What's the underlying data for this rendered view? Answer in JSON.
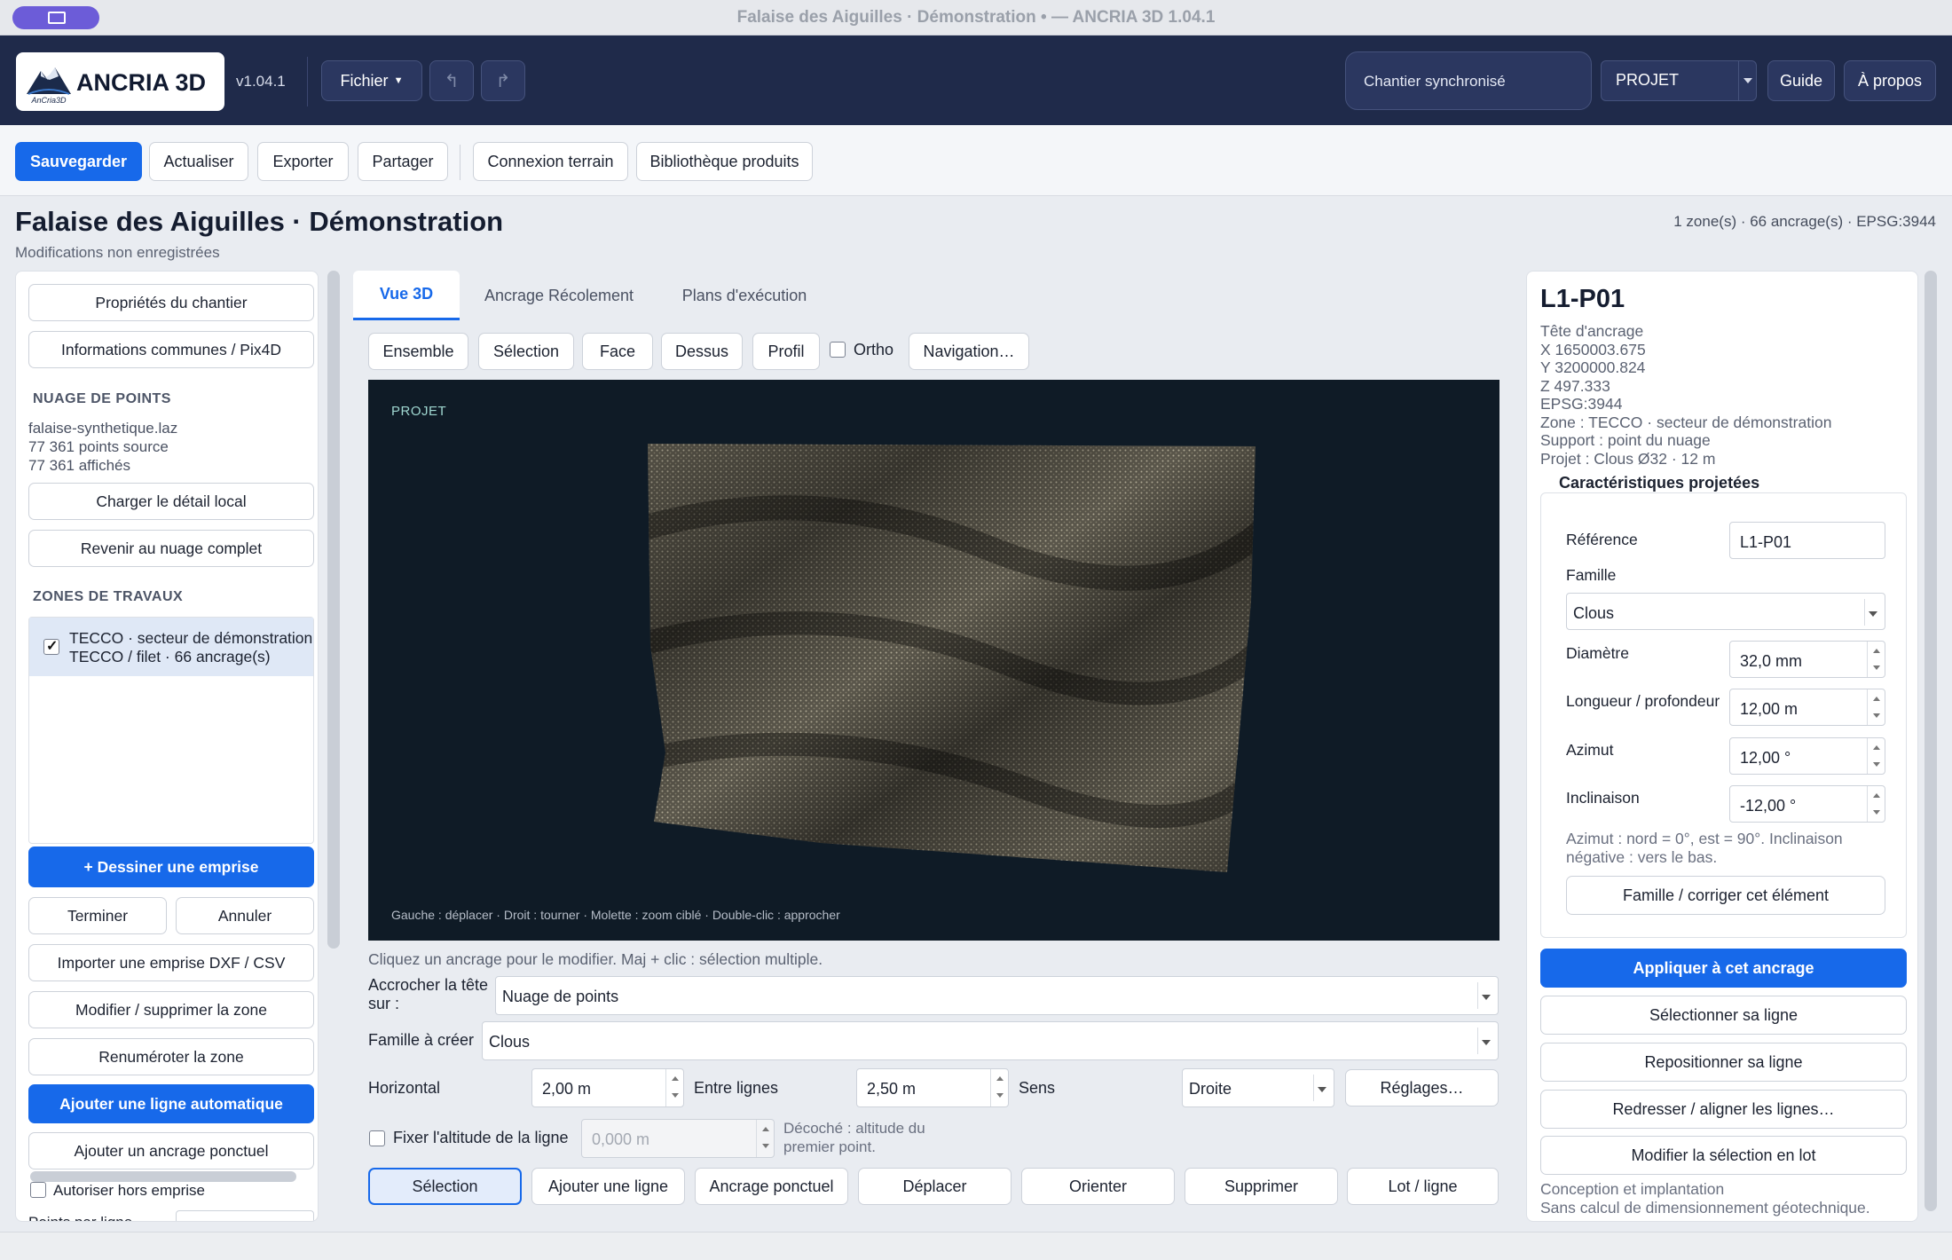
{
  "window": {
    "title": "Falaise des Aiguilles · Démonstration • — ANCRIA 3D 1.04.1"
  },
  "header": {
    "app_name": "ANCRIA 3D",
    "version": "v1.04.1",
    "file_menu": "Fichier",
    "undo_icon": "undo-icon",
    "redo_icon": "redo-icon",
    "sync_status": "Chantier synchronisé",
    "project_select": "PROJET",
    "guide": "Guide",
    "about": "À propos"
  },
  "toolbar": {
    "save": "Sauvegarder",
    "refresh": "Actualiser",
    "export": "Exporter",
    "share": "Partager",
    "field_connection": "Connexion terrain",
    "product_library": "Bibliothèque produits"
  },
  "page": {
    "title": "Falaise des Aiguilles · Démonstration",
    "subtitle": "Modifications non enregistrées",
    "stats": "1 zone(s)  ·  66 ancrage(s)  ·  EPSG:3944"
  },
  "left": {
    "site_props": "Propriétés du chantier",
    "common_info": "Informations communes / Pix4D",
    "cloud_header": "NUAGE DE POINTS",
    "cloud_file": "falaise-synthetique.laz",
    "cloud_source": "77 361 points source",
    "cloud_shown": "77 361 affichés",
    "load_detail": "Charger le détail local",
    "back_full": "Revenir au nuage complet",
    "zones_header": "ZONES DE TRAVAUX",
    "zone_line1": "TECCO · secteur de démonstration",
    "zone_line2": "TECCO / filet · 66 ancrage(s)",
    "draw_area": "+ Dessiner une emprise",
    "finish": "Terminer",
    "cancel": "Annuler",
    "import_dxf": "Importer une emprise DXF / CSV",
    "edit_zone": "Modifier / supprimer la zone",
    "renumber": "Renuméroter la zone",
    "add_auto_line": "Ajouter une ligne automatique",
    "add_anchor": "Ajouter un ancrage ponctuel",
    "allow_outside": "Autoriser hors emprise",
    "points_per_line": "Points par ligne"
  },
  "center": {
    "tabs": [
      "Vue 3D",
      "Ancrage Récolement",
      "Plans d'exécution"
    ],
    "views": [
      "Ensemble",
      "Sélection",
      "Face",
      "Dessus",
      "Profil"
    ],
    "ortho": "Ortho",
    "navigation": "Navigation…",
    "viewport_label": "PROJET",
    "viewport_help": "Gauche : déplacer · Droit : tourner · Molette : zoom ciblé · Double-clic : approcher",
    "hint": "Cliquez un ancrage pour le modifier. Maj + clic : sélection multiple.",
    "snap_label": "Accrocher la tête sur :",
    "snap_value": "Nuage de points",
    "family_label": "Famille à créer",
    "family_value": "Clous",
    "horizontal_label": "Horizontal",
    "horizontal_value": "2,00 m",
    "between_label": "Entre lignes",
    "between_value": "2,50 m",
    "direction_label": "Sens",
    "direction_value": "Droite",
    "settings": "Réglages…",
    "fix_alt_label": "Fixer l'altitude de la ligne",
    "fix_alt_value": "0,000 m",
    "fix_alt_note": "Décoché : altitude du premier point.",
    "modes": [
      "Sélection",
      "Ajouter une ligne",
      "Ancrage ponctuel",
      "Déplacer",
      "Orienter",
      "Supprimer",
      "Lot / ligne"
    ]
  },
  "right": {
    "title": "L1-P01",
    "meta": [
      "Tête d'ancrage",
      "X  1650003.675",
      "Y  3200000.824",
      "Z  497.333",
      "EPSG:3944",
      "Zone : TECCO · secteur de démonstration",
      "Support : point du nuage",
      "Projet : Clous Ø32 · 12 m"
    ],
    "section": "Caractéristiques projetées",
    "reference_label": "Référence",
    "reference_value": "L1-P01",
    "family_label": "Famille",
    "family_value": "Clous",
    "diameter_label": "Diamètre",
    "diameter_value": "32,0 mm",
    "length_label": "Longueur / profondeur",
    "length_value": "12,00 m",
    "azimuth_label": "Azimut",
    "azimuth_value": "12,00 °",
    "incl_label": "Inclinaison",
    "incl_value": "-12,00 °",
    "note": "Azimut : nord = 0°, est = 90°. Inclinaison négative : vers le bas.",
    "fix_family": "Famille / corriger cet élément",
    "apply": "Appliquer à cet ancrage",
    "select_line": "Sélectionner sa ligne",
    "reposition_line": "Repositionner sa ligne",
    "straighten": "Redresser / aligner les lignes…",
    "batch_edit": "Modifier la sélection en lot",
    "footer1": "Conception et implantation",
    "footer2": "Sans calcul de dimensionnement géotechnique."
  },
  "colors": {
    "accent": "#1769ea",
    "header": "#1f2a4a",
    "viewport": "#0f1b26"
  }
}
